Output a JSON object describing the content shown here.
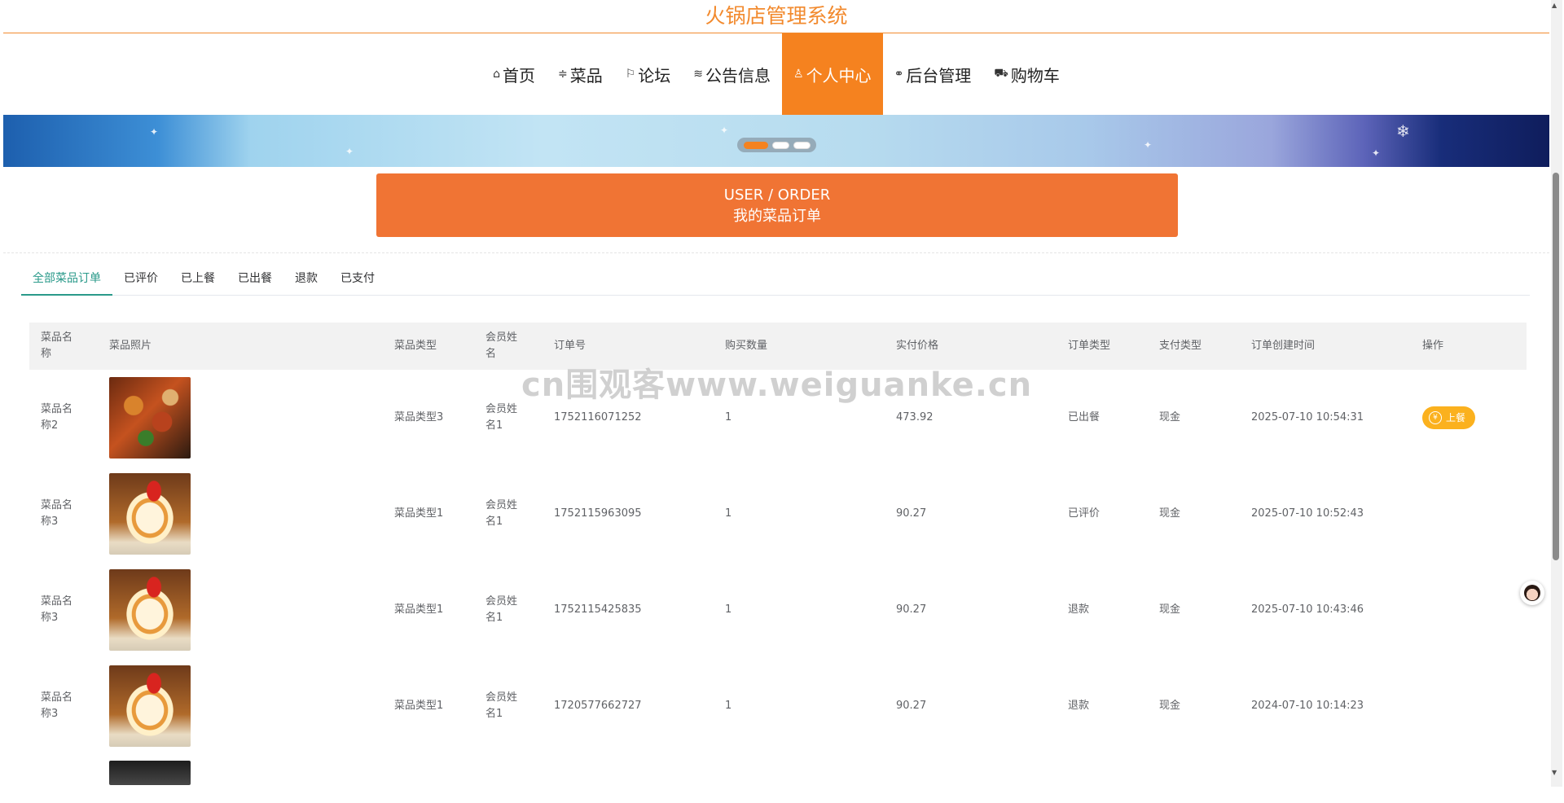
{
  "site": {
    "title": "火锅店管理系统"
  },
  "nav": {
    "items": [
      {
        "label": "首页",
        "icon": "home-icon",
        "active": false
      },
      {
        "label": "菜品",
        "icon": "sliders-icon",
        "active": false
      },
      {
        "label": "论坛",
        "icon": "flag-icon",
        "active": false
      },
      {
        "label": "公告信息",
        "icon": "graduation-cap-icon",
        "active": false
      },
      {
        "label": "个人中心",
        "icon": "user-icon",
        "active": true
      },
      {
        "label": "后台管理",
        "icon": "link-icon",
        "active": false
      },
      {
        "label": "购物车",
        "icon": "cart-icon",
        "active": false
      }
    ]
  },
  "carousel": {
    "slides": 3,
    "active_index": 0
  },
  "section": {
    "title_en": "USER / ORDER",
    "title_cn": "我的菜品订单"
  },
  "tabs": [
    {
      "label": "全部菜品订单",
      "active": true
    },
    {
      "label": "已评价",
      "active": false
    },
    {
      "label": "已上餐",
      "active": false
    },
    {
      "label": "已出餐",
      "active": false
    },
    {
      "label": "退款",
      "active": false
    },
    {
      "label": "已支付",
      "active": false
    }
  ],
  "table": {
    "headers": [
      "菜品名称",
      "菜品照片",
      "菜品类型",
      "会员姓名",
      "订单号",
      "购买数量",
      "实付价格",
      "订单类型",
      "支付类型",
      "订单创建时间",
      "操作"
    ],
    "rows": [
      {
        "name": "菜品名称2",
        "photo": "food-a",
        "type": "菜品类型3",
        "member": "会员姓名1",
        "order_no": "1752116071252",
        "qty": "1",
        "price": "473.92",
        "order_type": "已出餐",
        "pay_type": "现金",
        "created": "2025-07-10 10:54:31",
        "action": "上餐"
      },
      {
        "name": "菜品名称3",
        "photo": "food-b",
        "type": "菜品类型1",
        "member": "会员姓名1",
        "order_no": "1752115963095",
        "qty": "1",
        "price": "90.27",
        "order_type": "已评价",
        "pay_type": "现金",
        "created": "2025-07-10 10:52:43",
        "action": ""
      },
      {
        "name": "菜品名称3",
        "photo": "food-b",
        "type": "菜品类型1",
        "member": "会员姓名1",
        "order_no": "1752115425835",
        "qty": "1",
        "price": "90.27",
        "order_type": "退款",
        "pay_type": "现金",
        "created": "2025-07-10 10:43:46",
        "action": ""
      },
      {
        "name": "菜品名称3",
        "photo": "food-b",
        "type": "菜品类型1",
        "member": "会员姓名1",
        "order_no": "1720577662727",
        "qty": "1",
        "price": "90.27",
        "order_type": "退款",
        "pay_type": "现金",
        "created": "2024-07-10 10:14:23",
        "action": ""
      },
      {
        "name": "",
        "photo": "food-c",
        "type": "",
        "member": "",
        "order_no": "",
        "qty": "",
        "price": "",
        "order_type": "",
        "pay_type": "",
        "created": "",
        "action": ""
      }
    ]
  },
  "watermark": "cn围观客www.weiguanke.cn",
  "colors": {
    "brand": "#f28a2e",
    "nav_active": "#f5821f",
    "section_bg": "#f07434",
    "tab_active": "#2a9a8a",
    "pay_button": "#fbb11e"
  }
}
